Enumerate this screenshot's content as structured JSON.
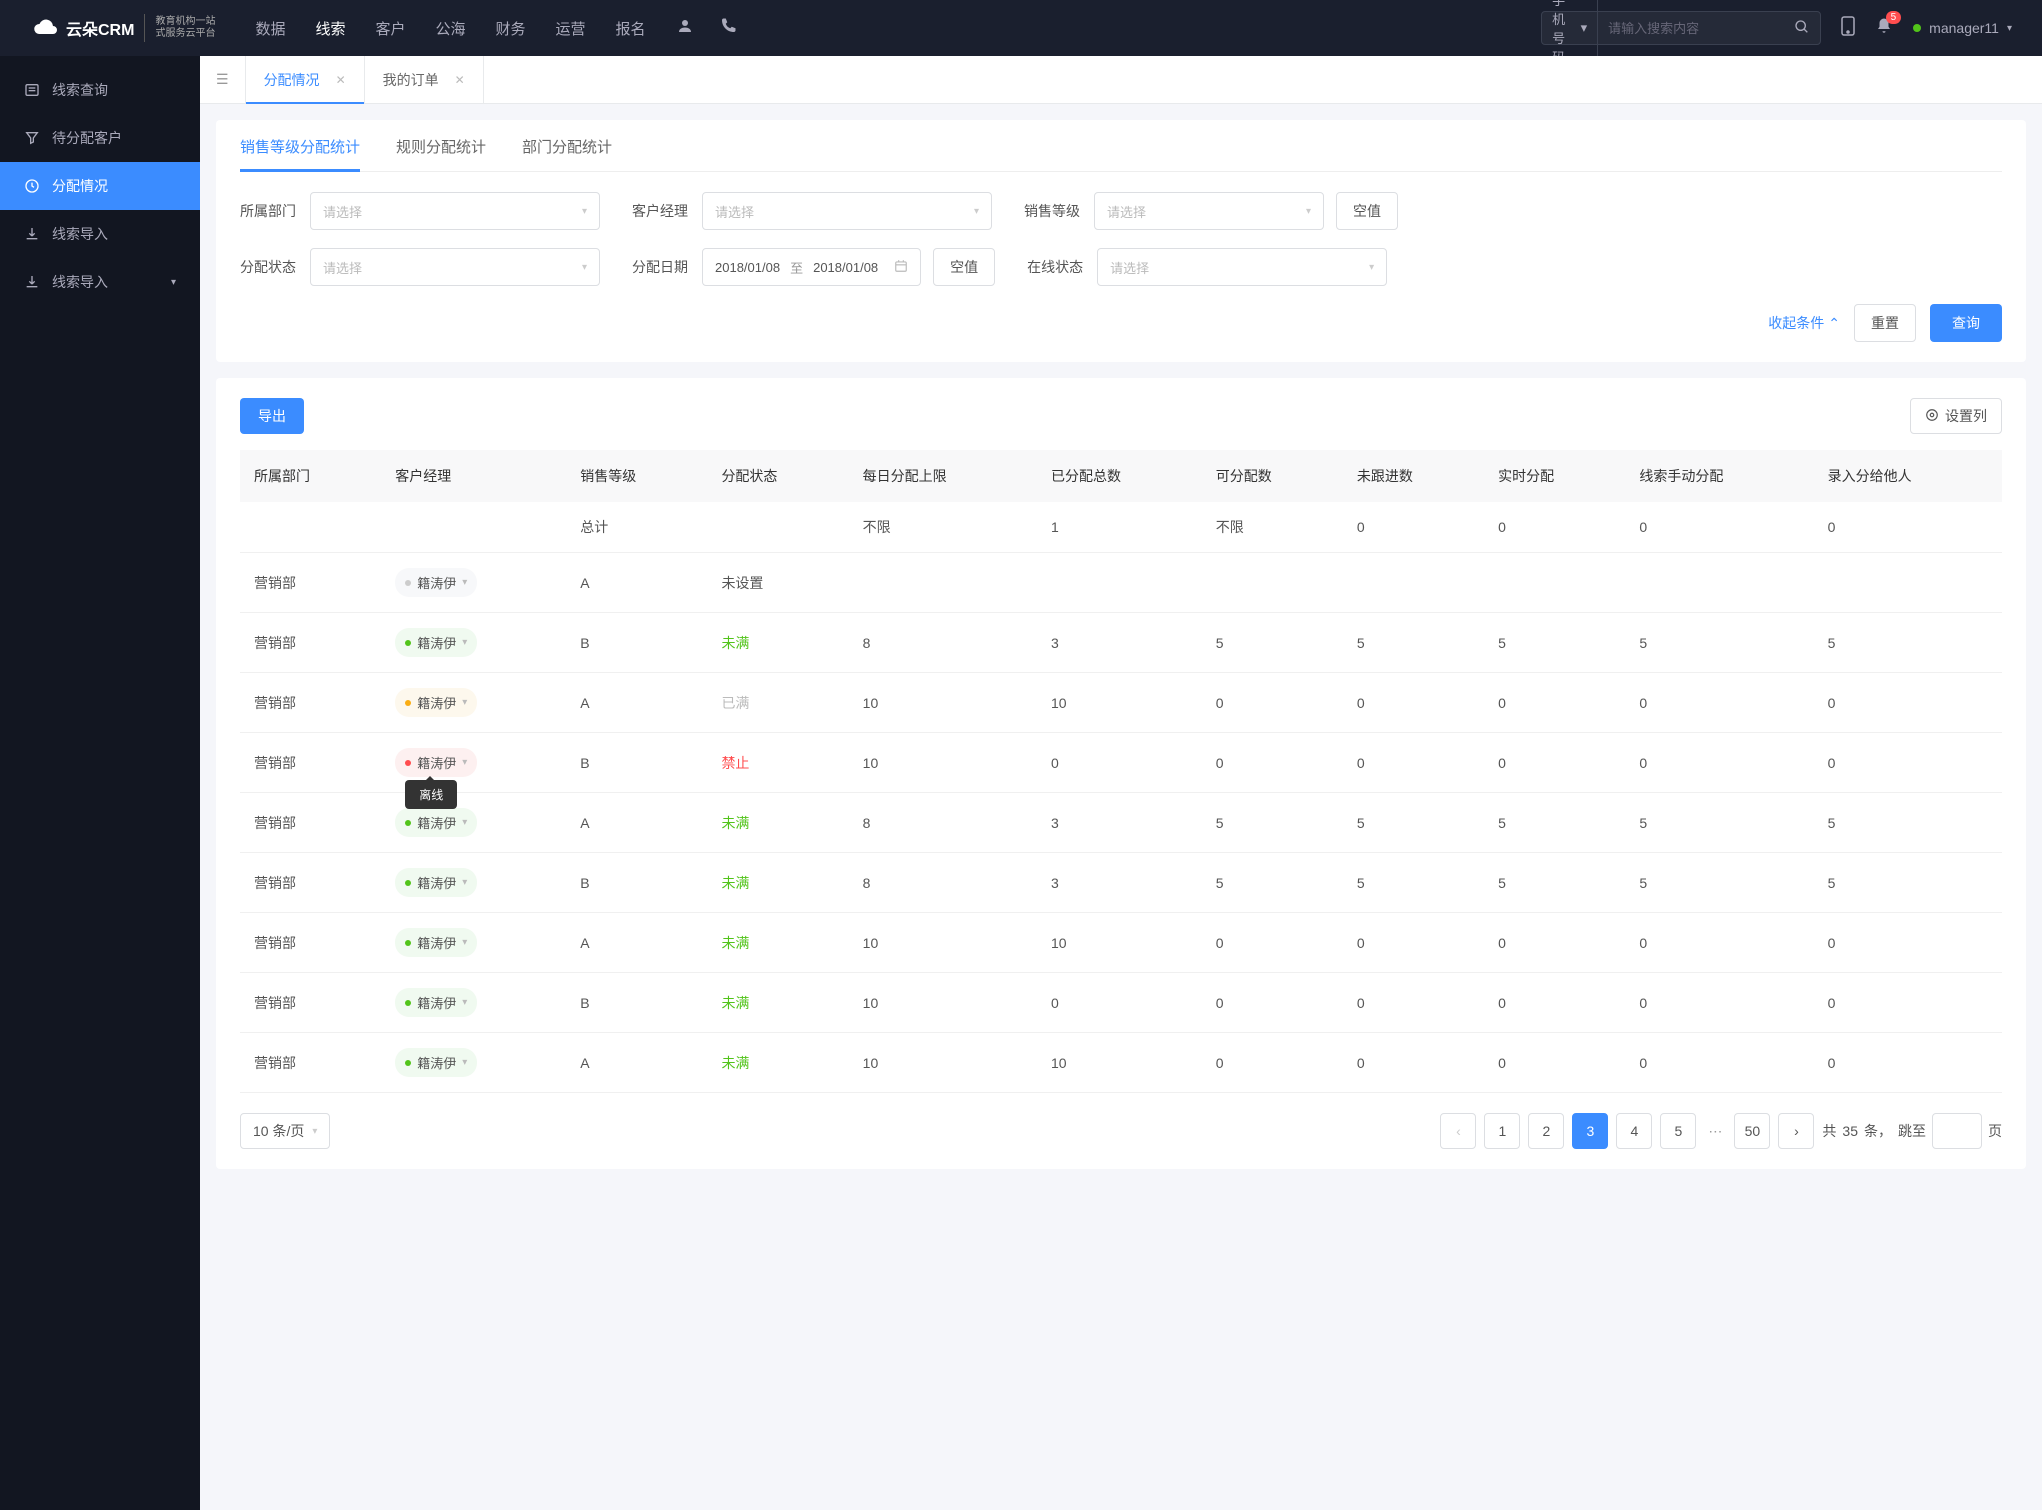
{
  "logo": {
    "main": "云朵CRM",
    "sub1": "教育机构一站",
    "sub2": "式服务云平台"
  },
  "topnav": {
    "items": [
      "数据",
      "线索",
      "客户",
      "公海",
      "财务",
      "运营",
      "报名"
    ],
    "active_index": 1,
    "search_type": "手机号码",
    "search_placeholder": "请输入搜索内容",
    "badge": "5",
    "username": "manager11"
  },
  "sidebar": {
    "items": [
      {
        "label": "线索查询",
        "icon": "list"
      },
      {
        "label": "待分配客户",
        "icon": "filter"
      },
      {
        "label": "分配情况",
        "icon": "clock",
        "active": true
      },
      {
        "label": "线索导入",
        "icon": "import"
      },
      {
        "label": "线索导入",
        "icon": "import",
        "expandable": true
      }
    ]
  },
  "tabs": [
    {
      "label": "分配情况",
      "active": true
    },
    {
      "label": "我的订单"
    }
  ],
  "subtabs": [
    {
      "label": "销售等级分配统计",
      "active": true
    },
    {
      "label": "规则分配统计"
    },
    {
      "label": "部门分配统计"
    }
  ],
  "filters": {
    "dept_label": "所属部门",
    "mgr_label": "客户经理",
    "level_label": "销售等级",
    "status_label": "分配状态",
    "date_label": "分配日期",
    "online_label": "在线状态",
    "placeholder": "请选择",
    "date_from": "2018/01/08",
    "date_to": "2018/01/08",
    "date_sep": "至",
    "empty_btn": "空值",
    "collapse": "收起条件",
    "reset": "重置",
    "search": "查询"
  },
  "toolbar": {
    "export": "导出",
    "settings": "设置列"
  },
  "table": {
    "headers": [
      "所属部门",
      "客户经理",
      "销售等级",
      "分配状态",
      "每日分配上限",
      "已分配总数",
      "可分配数",
      "未跟进数",
      "实时分配",
      "线索手动分配",
      "录入分给他人"
    ],
    "summary": {
      "label": "总计",
      "limit": "不限",
      "assigned": "1",
      "available": "不限",
      "unfollowed": "0",
      "realtime": "0",
      "manual": "0",
      "other": "0"
    },
    "rows": [
      {
        "dept": "营销部",
        "mgr": "籍涛伊",
        "dot": "grey",
        "level": "A",
        "status": "未设置",
        "status_cls": "",
        "limit": "",
        "assigned": "",
        "available": "",
        "unfollowed": "",
        "realtime": "",
        "manual": "",
        "other": ""
      },
      {
        "dept": "营销部",
        "mgr": "籍涛伊",
        "dot": "green",
        "level": "B",
        "status": "未满",
        "status_cls": "green",
        "limit": "8",
        "assigned": "3",
        "available": "5",
        "unfollowed": "5",
        "realtime": "5",
        "manual": "5",
        "other": "5"
      },
      {
        "dept": "营销部",
        "mgr": "籍涛伊",
        "dot": "yellow",
        "level": "A",
        "status": "已满",
        "status_cls": "grey",
        "limit": "10",
        "assigned": "10",
        "available": "0",
        "unfollowed": "0",
        "realtime": "0",
        "manual": "0",
        "other": "0"
      },
      {
        "dept": "营销部",
        "mgr": "籍涛伊",
        "dot": "red",
        "level": "B",
        "status": "禁止",
        "status_cls": "red",
        "limit": "10",
        "assigned": "0",
        "available": "0",
        "unfollowed": "0",
        "realtime": "0",
        "manual": "0",
        "other": "0",
        "tooltip": "离线"
      },
      {
        "dept": "营销部",
        "mgr": "籍涛伊",
        "dot": "green",
        "level": "A",
        "status": "未满",
        "status_cls": "green",
        "limit": "8",
        "assigned": "3",
        "available": "5",
        "unfollowed": "5",
        "realtime": "5",
        "manual": "5",
        "other": "5"
      },
      {
        "dept": "营销部",
        "mgr": "籍涛伊",
        "dot": "green",
        "level": "B",
        "status": "未满",
        "status_cls": "green",
        "limit": "8",
        "assigned": "3",
        "available": "5",
        "unfollowed": "5",
        "realtime": "5",
        "manual": "5",
        "other": "5"
      },
      {
        "dept": "营销部",
        "mgr": "籍涛伊",
        "dot": "green",
        "level": "A",
        "status": "未满",
        "status_cls": "green",
        "limit": "10",
        "assigned": "10",
        "available": "0",
        "unfollowed": "0",
        "realtime": "0",
        "manual": "0",
        "other": "0"
      },
      {
        "dept": "营销部",
        "mgr": "籍涛伊",
        "dot": "green",
        "level": "B",
        "status": "未满",
        "status_cls": "green",
        "limit": "10",
        "assigned": "0",
        "available": "0",
        "unfollowed": "0",
        "realtime": "0",
        "manual": "0",
        "other": "0"
      },
      {
        "dept": "营销部",
        "mgr": "籍涛伊",
        "dot": "green",
        "level": "A",
        "status": "未满",
        "status_cls": "green",
        "limit": "10",
        "assigned": "10",
        "available": "0",
        "unfollowed": "0",
        "realtime": "0",
        "manual": "0",
        "other": "0"
      }
    ]
  },
  "pagination": {
    "page_size": "10 条/页",
    "pages": [
      "1",
      "2",
      "3",
      "4",
      "5"
    ],
    "active": "3",
    "last": "50",
    "total_prefix": "共",
    "total_count": "35",
    "total_suffix": "条，",
    "jump_label": "跳至",
    "page_suffix": "页"
  }
}
